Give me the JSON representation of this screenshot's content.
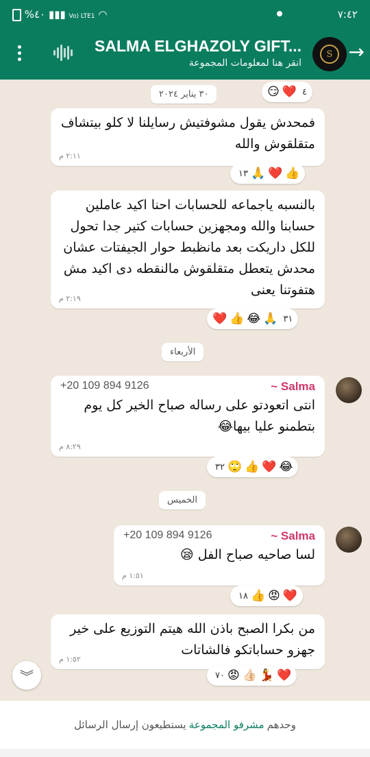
{
  "status_bar": {
    "time": "٧:٤٢",
    "battery": "%٤٠",
    "network": "Vo) LTE1"
  },
  "header": {
    "title": "SALMA ELGHAZOLY GIFT...",
    "subtitle": "انقر هنا لمعلومات المجموعة",
    "logo_letter": "S"
  },
  "messages": [
    {
      "date_pill": "٣٠ يناير ٢٠٢٤",
      "top_reactions": {
        "emojis": [
          "😏",
          "❤️"
        ],
        "count": "٤"
      }
    },
    {
      "text": "فمحدش يقول مشوفتيش رسايلنا لا كلو بيتشاف متقلقوش والله",
      "time": "٢:١١ م",
      "reactions": {
        "emojis": [
          "👍",
          "❤️",
          "🙏"
        ],
        "count": "١٣"
      }
    },
    {
      "text": "بالنسبه ياجماعه للحسابات احنا اكيد عاملين حسابنا والله ومجهزين حسابات كتير جدا تحول للكل داريكت بعد مانظبط حوار الجيفتات عشان محدش يتعطل متقلقوش مالنقطه دى اكيد مش هتفوتنا يعنى",
      "time": "٢:١٩ م",
      "reactions": {
        "emojis": [
          "❤️",
          "👍",
          "😂",
          "🙏"
        ],
        "count": "٣١"
      }
    },
    {
      "day": "الأربعاء",
      "sender": "~ Salma",
      "phone": "+20 109 894 9126",
      "text": "انتى اتعودتو على رساله صباح الخير كل يوم بتطمنو عليا بيها😂",
      "time": "٨:٢٩ م",
      "reactions": {
        "emojis": [
          "😂",
          "❤️",
          "👍",
          "🙄"
        ],
        "count": "٣٢"
      }
    },
    {
      "day": "الخميس",
      "sender": "~ Salma",
      "phone": "+20 109 894 9126",
      "text": "لسا صاحيه  صباح الفل 😪",
      "time": "١:٥١ م",
      "reactions": {
        "emojis": [
          "❤️",
          "😡",
          "👍"
        ],
        "count": "١٨"
      }
    },
    {
      "text": "من بكرا الصبح باذن الله هيتم التوزيع على خير جهزو حساباتكو فالشاتات",
      "time": "١:٥٢ م",
      "reactions": {
        "emojis": [
          "❤️",
          "💃",
          "👍🏻",
          "😡"
        ],
        "count": "٧٠"
      }
    }
  ],
  "footer": {
    "before": "وحدهم",
    "link": "مشرفو المجموعة",
    "after": "يستطيعون إرسال الرسائل"
  }
}
